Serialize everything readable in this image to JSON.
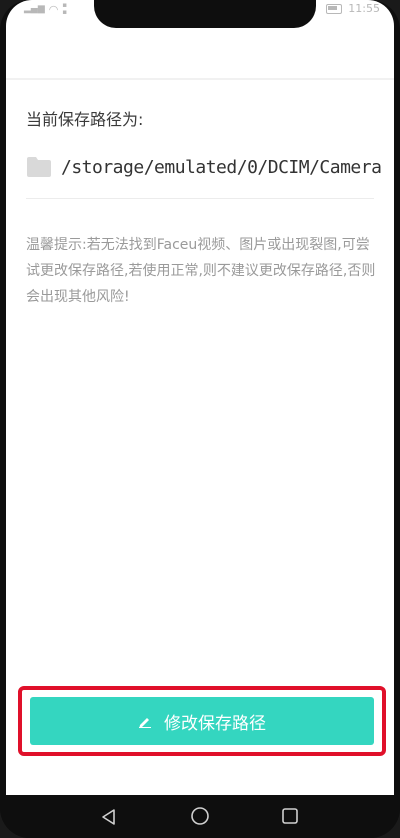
{
  "status_bar": {
    "time": "11:55"
  },
  "content": {
    "path_label": "当前保存路径为:",
    "path_value": "/storage/emulated/0/DCIM/Camera",
    "tip": "温馨提示:若无法找到Faceu视频、图片或出现裂图,可尝试更改保存路径,若使用正常,则不建议更改保存路径,否则会出现其他风险!"
  },
  "button": {
    "label": "修改保存路径"
  },
  "icons": {
    "folder": "folder-icon",
    "pencil": "pencil-icon",
    "back": "nav-back-icon",
    "home": "nav-home-icon",
    "recent": "nav-recent-icon"
  },
  "colors": {
    "button_bg": "#34d6c0",
    "highlight": "#e0102a",
    "folder": "#d9d9d9"
  }
}
